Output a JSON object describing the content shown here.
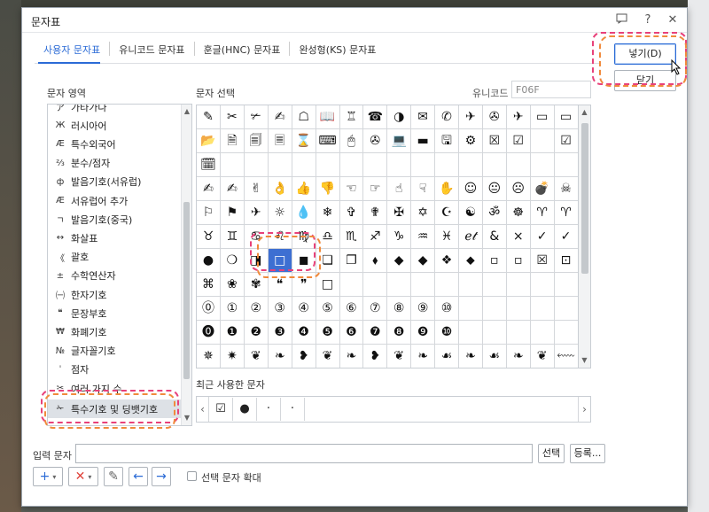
{
  "dialog": {
    "title": "문자표",
    "help_icon": "?",
    "close_icon": "✕"
  },
  "tabs": [
    {
      "label": "사용자 문자표",
      "active": true
    },
    {
      "label": "유니코드 문자표"
    },
    {
      "label": "훈글(HNC) 문자표"
    },
    {
      "label": "완성형(KS) 문자표"
    }
  ],
  "buttons": {
    "insert": "넣기(D)",
    "close": "닫기",
    "select": "선택",
    "register": "등록..."
  },
  "labels": {
    "char_area": "문자 영역",
    "char_select": "문자 선택",
    "unicode": "유니코드",
    "recent": "최근 사용한 문자",
    "input_char": "입력 문자",
    "enlarge": "선택 문자 확대"
  },
  "unicode_value": "F06F",
  "char_areas": [
    {
      "glyph": "ア",
      "label": "가타가나"
    },
    {
      "glyph": "Ж",
      "label": "러시아어"
    },
    {
      "glyph": "Æ",
      "label": "특수외국어"
    },
    {
      "glyph": "⅔",
      "label": "분수/점자"
    },
    {
      "glyph": "ф",
      "label": "발음기호(서유럽)"
    },
    {
      "glyph": "Æ",
      "label": "서유럽어 추가"
    },
    {
      "glyph": "ㄱ",
      "label": "발음기호(중국)"
    },
    {
      "glyph": "↔",
      "label": "화살표"
    },
    {
      "glyph": "《",
      "label": "괄호"
    },
    {
      "glyph": "±",
      "label": "수학연산자"
    },
    {
      "glyph": "㈠",
      "label": "한자기호"
    },
    {
      "glyph": "❝",
      "label": "문장부호"
    },
    {
      "glyph": "₩",
      "label": "화폐기호"
    },
    {
      "glyph": "№",
      "label": "글자꼴기호"
    },
    {
      "glyph": "ˈ",
      "label": "점자"
    },
    {
      "glyph": "✂",
      "label": "여러 가지 수"
    },
    {
      "glyph": "✁",
      "label": "특수기호 및 딩뱃기호",
      "selected": true
    }
  ],
  "grid_rows": [
    [
      "✎",
      "✂",
      "✃",
      "✍",
      "☖",
      "📖",
      "♖",
      "☎",
      "◑",
      "✉",
      "✆",
      "✈",
      "✇",
      "✈",
      "▭"
    ],
    [
      "📂",
      "🗎",
      "🗐",
      "🗏",
      "⌛",
      "⌨",
      "🖱",
      "✇",
      "💻",
      "▬",
      "🖫",
      "⚙",
      "☒",
      "☑",
      ""
    ],
    [
      "🗓",
      "",
      "",
      "",
      "",
      "",
      "",
      "",
      "",
      "",
      "",
      "",
      "",
      "",
      ""
    ],
    [
      "✍",
      "✍",
      "✌",
      "👌",
      "👍",
      "👎",
      "☜",
      "☞",
      "☝",
      "☟",
      "✋",
      "☺",
      "😐",
      "☹",
      "💣"
    ],
    [
      "⚐",
      "⚑",
      "✈",
      "☼",
      "💧",
      "❄",
      "✞",
      "✟",
      "✠",
      "✡",
      "☪",
      "☯",
      "ॐ",
      "☸",
      "♈"
    ],
    [
      "♉",
      "♊",
      "♋",
      "♌",
      "♍",
      "♎",
      "♏",
      "♐",
      "♑",
      "♒",
      "♓",
      "ℯ𝓉",
      "&",
      "×",
      "✓"
    ],
    [
      "●",
      "❍",
      "◨",
      "□",
      "◼",
      "❏",
      "❐",
      "⬧",
      "◆",
      "◆",
      "❖",
      "⬥",
      "▫",
      "▫",
      "☒"
    ],
    [
      "⌘",
      "❀",
      "✾",
      "❝",
      "❞",
      "□",
      "",
      "",
      "",
      "",
      "",
      "",
      "",
      "",
      ""
    ],
    [
      "⓪",
      "①",
      "②",
      "③",
      "④",
      "⑤",
      "⑥",
      "⑦",
      "⑧",
      "⑨",
      "⑩",
      "",
      "",
      "",
      ""
    ],
    [
      "⓿",
      "❶",
      "❷",
      "❸",
      "❹",
      "❺",
      "❻",
      "❼",
      "❽",
      "❾",
      "❿",
      "",
      "",
      "",
      ""
    ],
    [
      "✵",
      "✷",
      "❦",
      "❧",
      "❥",
      "❦",
      "❧",
      "❥",
      "❦",
      "❧",
      "☙",
      "❧",
      "☙",
      "❧",
      "❦"
    ]
  ],
  "grid_last_col": [
    "▭",
    "☑",
    "",
    "☠",
    "♈",
    "✓",
    "⊡",
    "",
    "",
    "",
    "⬳"
  ],
  "recent_chars": [
    "☑",
    "●",
    "·",
    "·"
  ],
  "tools": {
    "add": "+",
    "remove": "✕",
    "edit": "✎",
    "left": "←",
    "right": "→"
  },
  "colors": {
    "accent": "#2b6bd6",
    "callout_pink": "#e8417a",
    "callout_orange": "#f08a3c"
  }
}
